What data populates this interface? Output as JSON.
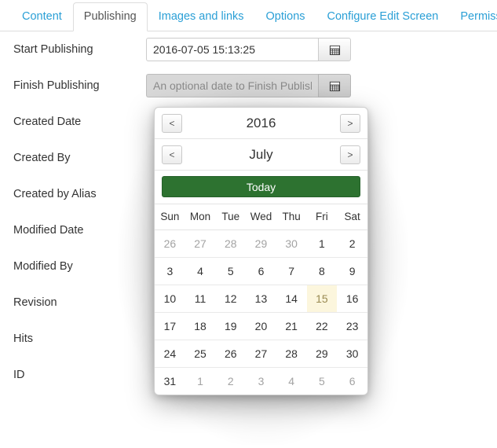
{
  "tabs": [
    {
      "label": "Content",
      "active": false
    },
    {
      "label": "Publishing",
      "active": true
    },
    {
      "label": "Images and links",
      "active": false
    },
    {
      "label": "Options",
      "active": false
    },
    {
      "label": "Configure Edit Screen",
      "active": false
    },
    {
      "label": "Permissions",
      "active": false
    }
  ],
  "form": {
    "rows": [
      {
        "label": "Start Publishing",
        "value": "2016-07-05 15:13:25",
        "placeholder": "",
        "has_field": true,
        "disabled": false
      },
      {
        "label": "Finish Publishing",
        "value": "",
        "placeholder": "An optional date to Finish Publishing",
        "has_field": true,
        "disabled": true
      },
      {
        "label": "Created Date",
        "has_field": false
      },
      {
        "label": "Created By",
        "has_field": false
      },
      {
        "label": "Created by Alias",
        "has_field": false
      },
      {
        "label": "Modified Date",
        "has_field": false
      },
      {
        "label": "Modified By",
        "has_field": false
      },
      {
        "label": "Revision",
        "has_field": false
      },
      {
        "label": "Hits",
        "has_field": false
      },
      {
        "label": "ID",
        "has_field": false
      }
    ],
    "calendar_icon_name": "calendar-icon"
  },
  "datepicker": {
    "year": "2016",
    "month": "July",
    "prev_label": "<",
    "next_label": ">",
    "today_label": "Today",
    "weekdays": [
      "Sun",
      "Mon",
      "Tue",
      "Wed",
      "Thu",
      "Fri",
      "Sat"
    ],
    "weeks": [
      [
        {
          "d": "26",
          "muted": true
        },
        {
          "d": "27",
          "muted": true
        },
        {
          "d": "28",
          "muted": true
        },
        {
          "d": "29",
          "muted": true
        },
        {
          "d": "30",
          "muted": true
        },
        {
          "d": "1"
        },
        {
          "d": "2"
        }
      ],
      [
        {
          "d": "3"
        },
        {
          "d": "4"
        },
        {
          "d": "5"
        },
        {
          "d": "6"
        },
        {
          "d": "7"
        },
        {
          "d": "8"
        },
        {
          "d": "9"
        }
      ],
      [
        {
          "d": "10"
        },
        {
          "d": "11"
        },
        {
          "d": "12"
        },
        {
          "d": "13"
        },
        {
          "d": "14"
        },
        {
          "d": "15",
          "selected": true
        },
        {
          "d": "16"
        }
      ],
      [
        {
          "d": "17"
        },
        {
          "d": "18"
        },
        {
          "d": "19"
        },
        {
          "d": "20"
        },
        {
          "d": "21"
        },
        {
          "d": "22"
        },
        {
          "d": "23"
        }
      ],
      [
        {
          "d": "24"
        },
        {
          "d": "25"
        },
        {
          "d": "26"
        },
        {
          "d": "27"
        },
        {
          "d": "28"
        },
        {
          "d": "29"
        },
        {
          "d": "30"
        }
      ],
      [
        {
          "d": "31"
        },
        {
          "d": "1",
          "muted": true
        },
        {
          "d": "2",
          "muted": true
        },
        {
          "d": "3",
          "muted": true
        },
        {
          "d": "4",
          "muted": true
        },
        {
          "d": "5",
          "muted": true
        },
        {
          "d": "6",
          "muted": true
        }
      ]
    ]
  },
  "colors": {
    "tab_link": "#2a9fd6",
    "tab_active_text": "#555555",
    "today_green": "#2d7230",
    "selected_day_bg": "#fcf6dd",
    "selected_day_text": "#9a8a52",
    "border": "#dddddd"
  }
}
